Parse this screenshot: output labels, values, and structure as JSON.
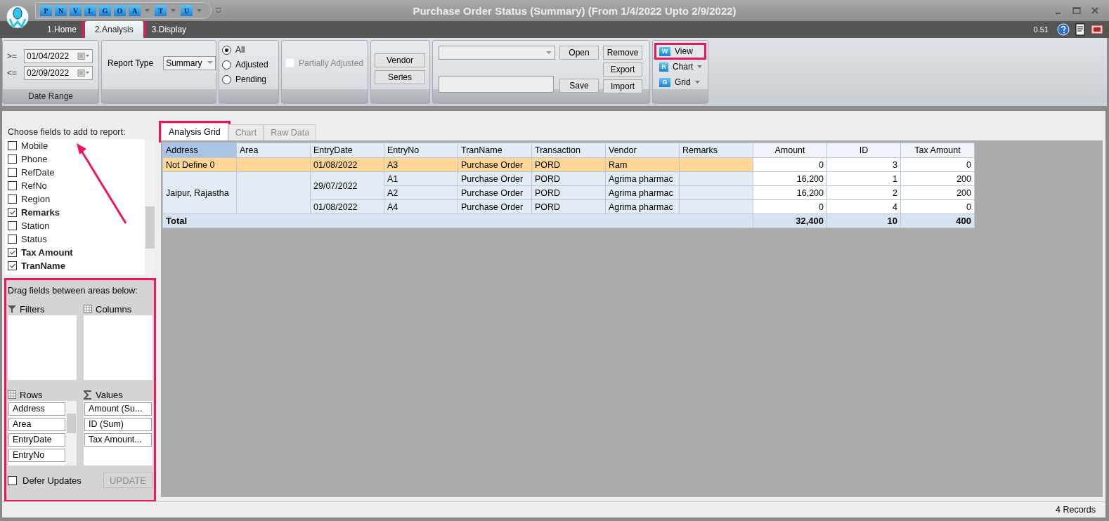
{
  "window": {
    "title": "Purchase Order Status (Summary)  (From 1/4/2022 Upto 2/9/2022)"
  },
  "quick_access": [
    {
      "letter": "P",
      "dropdown": false
    },
    {
      "letter": "N",
      "dropdown": false
    },
    {
      "letter": "V",
      "dropdown": false
    },
    {
      "letter": "L",
      "dropdown": false
    },
    {
      "letter": "G",
      "dropdown": false
    },
    {
      "letter": "O",
      "dropdown": false
    },
    {
      "letter": "A",
      "dropdown": true
    },
    {
      "letter": "T",
      "dropdown": true
    },
    {
      "letter": "U",
      "dropdown": true
    }
  ],
  "ribbon_tabs": [
    {
      "label": "1.Home",
      "selected": false,
      "highlighted": false
    },
    {
      "label": "2.Analysis",
      "selected": true,
      "highlighted": true
    },
    {
      "label": "3.Display",
      "selected": false,
      "highlighted": false
    }
  ],
  "version": "0.51",
  "date_range": {
    "caption": "Date Range",
    "from_label": ">=",
    "from": "01/04/2022",
    "to_label": "<=",
    "to": "02/09/2022"
  },
  "report_type": {
    "label": "Report Type",
    "value": "Summary"
  },
  "status_filter": [
    {
      "label": "All",
      "selected": true
    },
    {
      "label": "Adjusted",
      "selected": false
    },
    {
      "label": "Pending",
      "selected": false
    }
  ],
  "partially_adjusted": {
    "label": "Partially Adjusted",
    "checked": false,
    "disabled": true
  },
  "filter_buttons": [
    "Vendor",
    "Series"
  ],
  "layout_buttons": {
    "open": "Open",
    "save": "Save",
    "remove": "Remove",
    "export": "Export",
    "import": "Import"
  },
  "view_group": [
    {
      "label": "View",
      "icon": "W",
      "dropdown": false,
      "highlighted": true
    },
    {
      "label": "Chart",
      "icon": "R",
      "dropdown": true,
      "highlighted": false
    },
    {
      "label": "Grid",
      "icon": "G",
      "dropdown": true,
      "highlighted": false
    }
  ],
  "field_list": {
    "title": "Choose fields to add to report:",
    "items": [
      {
        "label": "Mobile",
        "checked": false
      },
      {
        "label": "Phone",
        "checked": false
      },
      {
        "label": "RefDate",
        "checked": false
      },
      {
        "label": "RefNo",
        "checked": false
      },
      {
        "label": "Region",
        "checked": false
      },
      {
        "label": "Remarks",
        "checked": true
      },
      {
        "label": "Station",
        "checked": false
      },
      {
        "label": "Status",
        "checked": false
      },
      {
        "label": "Tax Amount",
        "checked": true
      },
      {
        "label": "TranName",
        "checked": true
      }
    ]
  },
  "areas": {
    "title": "Drag fields between areas below:",
    "highlighted": true,
    "filters": "Filters",
    "columns": "Columns",
    "rows": "Rows",
    "values": "Values",
    "row_fields": [
      "Address",
      "Area",
      "EntryDate",
      "EntryNo"
    ],
    "value_fields": [
      "Amount (Su...",
      "ID (Sum)",
      "Tax Amount..."
    ],
    "defer": {
      "label": "Defer Updates",
      "checked": false
    },
    "update": "UPDATE"
  },
  "view_tabs": [
    {
      "label": "Analysis Grid",
      "selected": true,
      "highlighted": true
    },
    {
      "label": "Chart",
      "selected": false,
      "highlighted": false
    },
    {
      "label": "Raw Data",
      "selected": false,
      "highlighted": false
    }
  ],
  "table": {
    "columns": [
      {
        "label": "Address",
        "kind": "row",
        "selected": true
      },
      {
        "label": "Area",
        "kind": "row",
        "selected": false
      },
      {
        "label": "EntryDate",
        "kind": "row",
        "selected": false
      },
      {
        "label": "EntryNo",
        "kind": "row",
        "selected": false
      },
      {
        "label": "TranName",
        "kind": "row",
        "selected": false
      },
      {
        "label": "Transaction",
        "kind": "row",
        "selected": false
      },
      {
        "label": "Vendor",
        "kind": "row",
        "selected": false
      },
      {
        "label": "Remarks",
        "kind": "row",
        "selected": false
      },
      {
        "label": "Amount",
        "kind": "value",
        "selected": false
      },
      {
        "label": "ID",
        "kind": "value",
        "selected": false
      },
      {
        "label": "Tax Amount",
        "kind": "value",
        "selected": false
      }
    ],
    "groups": [
      {
        "address": "Not Define 0",
        "selected": true,
        "dates": [
          {
            "date": "01/08/2022",
            "entries": [
              {
                "entry_no": "A3",
                "tran_name": "Purchase Order",
                "transaction": "PORD",
                "vendor": "Ram",
                "amount": "0",
                "id": "3",
                "tax_amount": "0"
              }
            ]
          }
        ]
      },
      {
        "address": "Jaipur, Rajastha",
        "selected": false,
        "dates": [
          {
            "date": "29/07/2022",
            "entries": [
              {
                "entry_no": "A1",
                "tran_name": "Purchase Order",
                "transaction": "PORD",
                "vendor": "Agrima pharmac",
                "amount": "16,200",
                "id": "1",
                "tax_amount": "200"
              },
              {
                "entry_no": "A2",
                "tran_name": "Purchase Order",
                "transaction": "PORD",
                "vendor": "Agrima pharmac",
                "amount": "16,200",
                "id": "2",
                "tax_amount": "200"
              }
            ]
          },
          {
            "date": "01/08/2022",
            "entries": [
              {
                "entry_no": "A4",
                "tran_name": "Purchase Order",
                "transaction": "PORD",
                "vendor": "Agrima pharmac",
                "amount": "0",
                "id": "4",
                "tax_amount": "0"
              }
            ]
          }
        ]
      }
    ],
    "total": {
      "label": "Total",
      "amount": "32,400",
      "id": "10",
      "tax_amount": "400"
    }
  },
  "status_bar": {
    "records": "4 Records"
  }
}
